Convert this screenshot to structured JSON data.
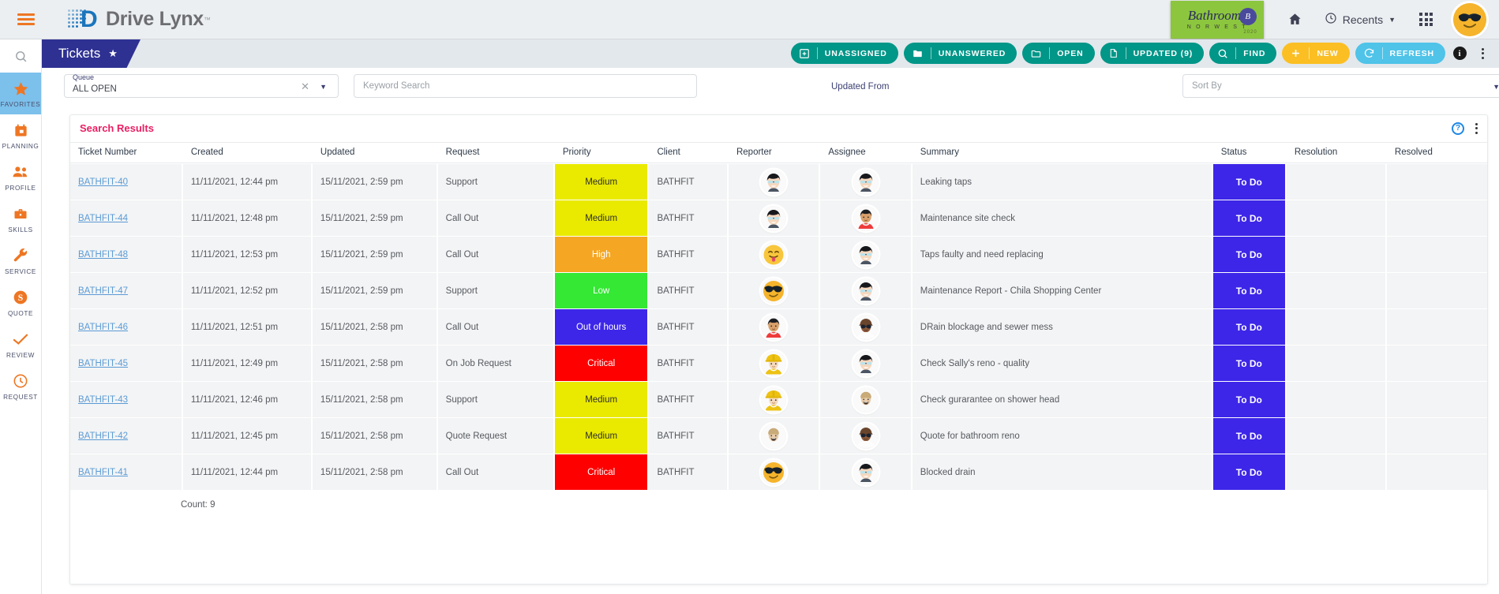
{
  "header": {
    "menu_icon": "hamburger-icon",
    "brand": "Drive Lynx",
    "brand_tm": "™",
    "client_logo": {
      "name": "Bathrooms",
      "sub": "N O R W E S T",
      "badge": "B",
      "year": "2020"
    },
    "home_icon": "home-icon",
    "recents_label": "Recents",
    "apps_icon": "grid-apps-icon",
    "avatar": "user-avatar"
  },
  "page": {
    "title": "Tickets",
    "favorite_icon": "star-icon"
  },
  "toolbar": {
    "buttons": [
      {
        "label": "UNASSIGNED",
        "icon": "add-box-icon",
        "color": "#009688"
      },
      {
        "label": "UNANSWERED",
        "icon": "folder-filled-icon",
        "color": "#009688"
      },
      {
        "label": "OPEN",
        "icon": "folder-outline-icon",
        "color": "#009688"
      },
      {
        "label": "UPDATED (9)",
        "icon": "document-icon",
        "color": "#009688"
      },
      {
        "label": "FIND",
        "icon": "search-icon",
        "color": "#009688"
      },
      {
        "label": "NEW",
        "icon": "plus-icon",
        "color": "#fbbf24"
      },
      {
        "label": "REFRESH",
        "icon": "refresh-icon",
        "color": "#4fc3e8"
      }
    ],
    "info_icon": "info-icon",
    "overflow_icon": "more-vertical-icon"
  },
  "sidebar": {
    "search_icon": "search-icon",
    "items": [
      {
        "label": "FAVORITES",
        "icon": "star-icon",
        "active": true
      },
      {
        "label": "PLANNING",
        "icon": "calendar-icon",
        "active": false
      },
      {
        "label": "PROFILE",
        "icon": "people-icon",
        "active": false
      },
      {
        "label": "SKILLS",
        "icon": "briefcase-icon",
        "active": false
      },
      {
        "label": "SERVICE",
        "icon": "wrench-icon",
        "active": false
      },
      {
        "label": "QUOTE",
        "icon": "dollar-icon",
        "active": false
      },
      {
        "label": "REVIEW",
        "icon": "check-icon",
        "active": false
      },
      {
        "label": "REQUEST",
        "icon": "clock-icon",
        "active": false
      }
    ]
  },
  "filters": {
    "queue_label": "Queue",
    "queue_value": "ALL OPEN",
    "clear_icon": "close-icon",
    "dropdown_icon": "chevron-down-icon",
    "keyword_placeholder": "Keyword Search",
    "keyword_value": "",
    "updated_from_label": "Updated From",
    "sort_placeholder": "Sort By",
    "sort_value": ""
  },
  "results": {
    "title": "Search Results",
    "help_icon": "help-icon",
    "overflow_icon": "more-vertical-icon",
    "columns": [
      "Ticket Number",
      "Created",
      "Updated",
      "Request",
      "Priority",
      "Client",
      "Reporter",
      "Assignee",
      "Summary",
      "Status",
      "Resolution",
      "Resolved"
    ],
    "count_label": "Count: 9",
    "priority_colors": {
      "Medium": "#eaea00",
      "High": "#f5a623",
      "Low": "#34e834",
      "Out of hours": "#3d26e8",
      "Critical": "#ff0000"
    },
    "priority_text_colors": {
      "Medium": "#2e2e2e",
      "High": "#ffffff",
      "Low": "#ffffff",
      "Out of hours": "#ffffff",
      "Critical": "#ffffff"
    },
    "status_color": "#3d26e8",
    "rows": [
      {
        "ticket": "BATHFIT-40",
        "created": "11/11/2021, 12:44 pm",
        "updated": "15/11/2021, 2:59 pm",
        "request": "Support",
        "priority": "Medium",
        "client": "BATHFIT",
        "reporter": "avatar-dark-hair-glasses",
        "assignee": "avatar-dark-hair-glasses",
        "summary": "Leaking taps",
        "status": "To Do",
        "resolution": "",
        "resolved": ""
      },
      {
        "ticket": "BATHFIT-44",
        "created": "11/11/2021, 12:48 pm",
        "updated": "15/11/2021, 2:59 pm",
        "request": "Call Out",
        "priority": "Medium",
        "client": "BATHFIT",
        "reporter": "avatar-dark-hair-glasses",
        "assignee": "avatar-red-shirt-woman",
        "summary": "Maintenance site check",
        "status": "To Do",
        "resolution": "",
        "resolved": ""
      },
      {
        "ticket": "BATHFIT-48",
        "created": "11/11/2021, 12:53 pm",
        "updated": "15/11/2021, 2:59 pm",
        "request": "Call Out",
        "priority": "High",
        "client": "BATHFIT",
        "reporter": "avatar-tongue-emoji",
        "assignee": "avatar-dark-hair-glasses",
        "summary": "Taps faulty and need replacing",
        "status": "To Do",
        "resolution": "",
        "resolved": ""
      },
      {
        "ticket": "BATHFIT-47",
        "created": "11/11/2021, 12:52 pm",
        "updated": "15/11/2021, 2:59 pm",
        "request": "Support",
        "priority": "Low",
        "client": "BATHFIT",
        "reporter": "avatar-sunglasses-emoji",
        "assignee": "avatar-dark-hair-glasses",
        "summary": "Maintenance Report - Chila Shopping Center",
        "status": "To Do",
        "resolution": "",
        "resolved": ""
      },
      {
        "ticket": "BATHFIT-46",
        "created": "11/11/2021, 12:51 pm",
        "updated": "15/11/2021, 2:58 pm",
        "request": "Call Out",
        "priority": "Out of hours",
        "client": "BATHFIT",
        "reporter": "avatar-red-shirt-woman",
        "assignee": "avatar-cap-sunglasses-man",
        "summary": "DRain blockage and sewer mess",
        "status": "To Do",
        "resolution": "",
        "resolved": ""
      },
      {
        "ticket": "BATHFIT-45",
        "created": "11/11/2021, 12:49 pm",
        "updated": "15/11/2021, 2:58 pm",
        "request": "On Job Request",
        "priority": "Critical",
        "client": "BATHFIT",
        "reporter": "avatar-hardhat-worker",
        "assignee": "avatar-dark-hair-glasses",
        "summary": "Check Sally's reno - quality",
        "status": "To Do",
        "resolution": "",
        "resolved": ""
      },
      {
        "ticket": "BATHFIT-43",
        "created": "11/11/2021, 12:46 pm",
        "updated": "15/11/2021, 2:58 pm",
        "request": "Support",
        "priority": "Medium",
        "client": "BATHFIT",
        "reporter": "avatar-hardhat-worker",
        "assignee": "avatar-blonde-smiling",
        "summary": "Check gurarantee on shower head",
        "status": "To Do",
        "resolution": "",
        "resolved": ""
      },
      {
        "ticket": "BATHFIT-42",
        "created": "11/11/2021, 12:45 pm",
        "updated": "15/11/2021, 2:58 pm",
        "request": "Quote Request",
        "priority": "Medium",
        "client": "BATHFIT",
        "reporter": "avatar-blonde-smiling",
        "assignee": "avatar-cap-sunglasses-man",
        "summary": "Quote for bathroom reno",
        "status": "To Do",
        "resolution": "",
        "resolved": ""
      },
      {
        "ticket": "BATHFIT-41",
        "created": "11/11/2021, 12:44 pm",
        "updated": "15/11/2021, 2:58 pm",
        "request": "Call Out",
        "priority": "Critical",
        "client": "BATHFIT",
        "reporter": "avatar-sunglasses-emoji",
        "assignee": "avatar-dark-hair-glasses",
        "summary": "Blocked drain",
        "status": "To Do",
        "resolution": "",
        "resolved": ""
      }
    ]
  }
}
